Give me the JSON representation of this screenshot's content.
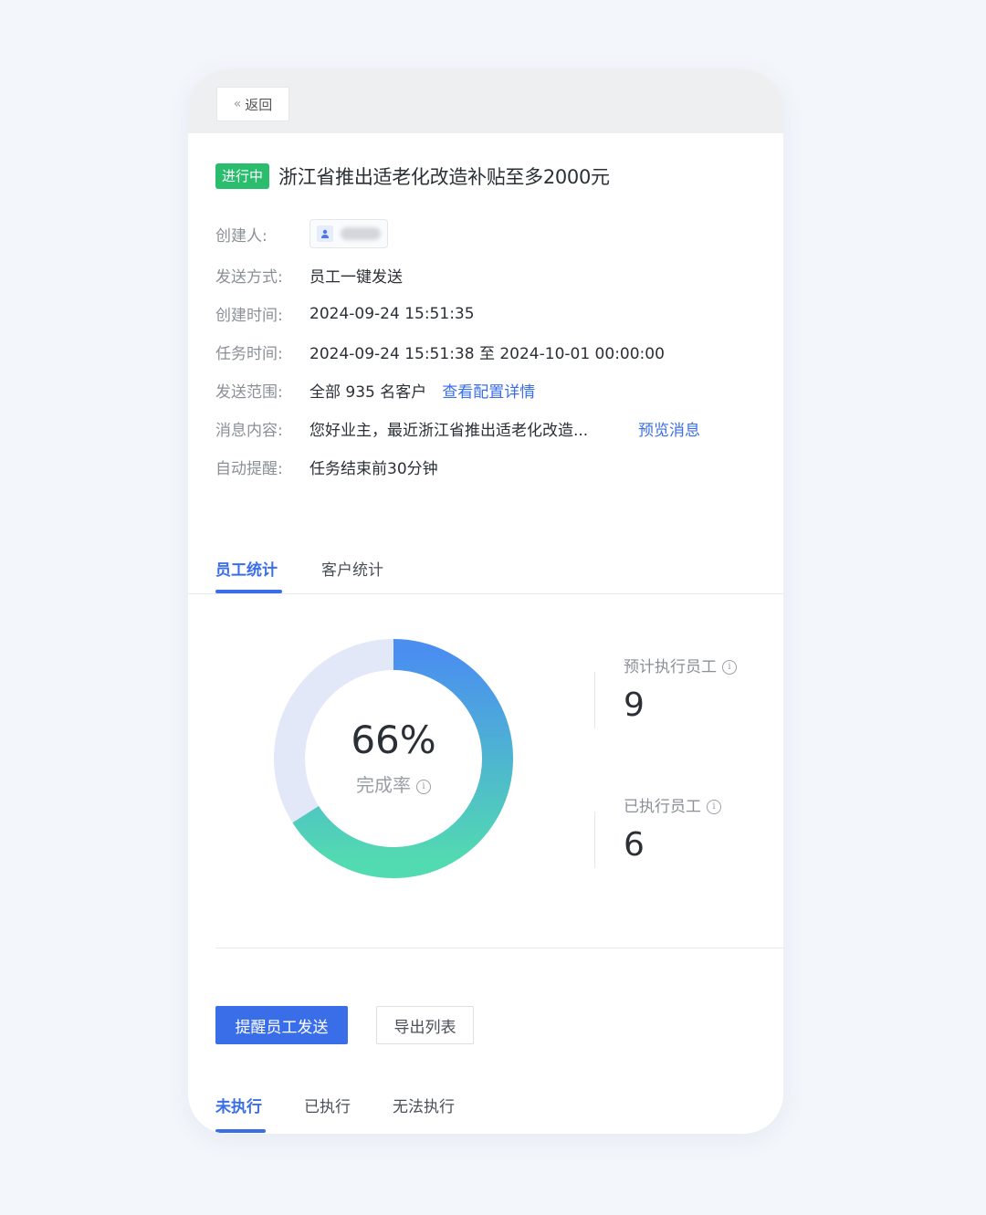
{
  "back": {
    "label": "返回",
    "chevron": "«"
  },
  "task": {
    "status": "进行中",
    "title": "浙江省推出适老化改造补贴至多2000元"
  },
  "info": {
    "creator_label": "创建人:",
    "send_method_label": "发送方式:",
    "send_method": "员工一键发送",
    "created_time_label": "创建时间:",
    "created_time": "2024-09-24 15:51:35",
    "task_time_label": "任务时间:",
    "task_time": "2024-09-24 15:51:38 至 2024-10-01 00:00:00",
    "scope_label": "发送范围:",
    "scope": "全部 935 名客户",
    "scope_link": "查看配置详情",
    "message_label": "消息内容:",
    "message": "您好业主，最近浙江省推出适老化改造...",
    "message_link": "预览消息",
    "reminder_label": "自动提醒:",
    "reminder": "任务结束前30分钟"
  },
  "stats_tabs": {
    "employee": "员工统计",
    "customer": "客户统计"
  },
  "donut": {
    "value_text": "66%",
    "label": "完成率",
    "fraction": 0.66,
    "colors": {
      "start": "#4a8ff0",
      "end": "#52dbb0",
      "track": "#e3e8f8"
    }
  },
  "stats": {
    "expected_label": "预计执行员工",
    "expected_value": "9",
    "executed_label": "已执行员工",
    "executed_value": "6"
  },
  "actions": {
    "remind": "提醒员工发送",
    "export": "导出列表"
  },
  "list_tabs": {
    "not_executed": "未执行",
    "executed": "已执行",
    "cannot_execute": "无法执行"
  },
  "theme": {
    "accent": "#3a6ee8",
    "status_green": "#2bbd6e"
  }
}
